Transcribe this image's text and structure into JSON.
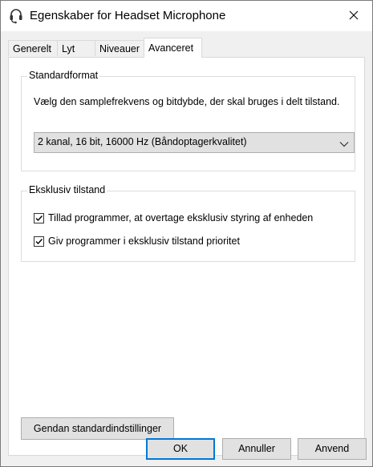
{
  "window": {
    "title": "Egenskaber for Headset Microphone"
  },
  "tabs": [
    {
      "label": "Generelt"
    },
    {
      "label": "Lyt"
    },
    {
      "label": "Niveauer"
    },
    {
      "label": "Avanceret"
    }
  ],
  "active_tab": "Avanceret",
  "default_format": {
    "legend": "Standardformat",
    "description": "Vælg den samplefrekvens og bitdybde, der skal bruges i delt tilstand.",
    "selected_format": "2 kanal, 16 bit, 16000 Hz (Båndoptagerkvalitet)"
  },
  "exclusive_mode": {
    "legend": "Eksklusiv tilstand",
    "options": [
      {
        "label": "Tillad programmer, at overtage eksklusiv styring af enheden",
        "checked": true
      },
      {
        "label": "Giv programmer i eksklusiv tilstand prioritet",
        "checked": true
      }
    ]
  },
  "restore_defaults_label": "Gendan standardindstillinger",
  "buttons": {
    "ok": "OK",
    "cancel": "Annuller",
    "apply": "Anvend"
  },
  "icons": {
    "window_icon": "headset-icon",
    "close": "close-icon",
    "dropdown": "chevron-down-icon",
    "checkbox": "check-icon"
  },
  "colors": {
    "focus_border": "#0078d7",
    "button_face": "#e1e1e1",
    "dialog_background": "#f0f0f0"
  }
}
